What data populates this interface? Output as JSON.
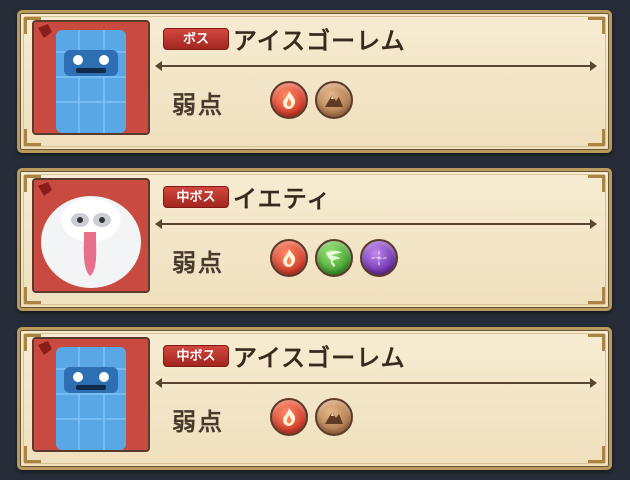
{
  "weakness_label": "弱点",
  "cards": [
    {
      "rank": "ボス",
      "name": "アイスゴーレム",
      "portrait": "ice-golem",
      "weaknesses": [
        "fire",
        "earth"
      ]
    },
    {
      "rank": "中ボス",
      "name": "イエティ",
      "portrait": "yeti",
      "weaknesses": [
        "fire",
        "wind",
        "dark"
      ]
    },
    {
      "rank": "中ボス",
      "name": "アイスゴーレム",
      "portrait": "ice-golem",
      "weaknesses": [
        "fire",
        "earth"
      ]
    }
  ],
  "colors": {
    "rank_badge": "#b8322a",
    "fire": "#d23a2a",
    "earth": "#b07a4c",
    "wind": "#3e9a2e",
    "dark": "#6b2fa8"
  }
}
